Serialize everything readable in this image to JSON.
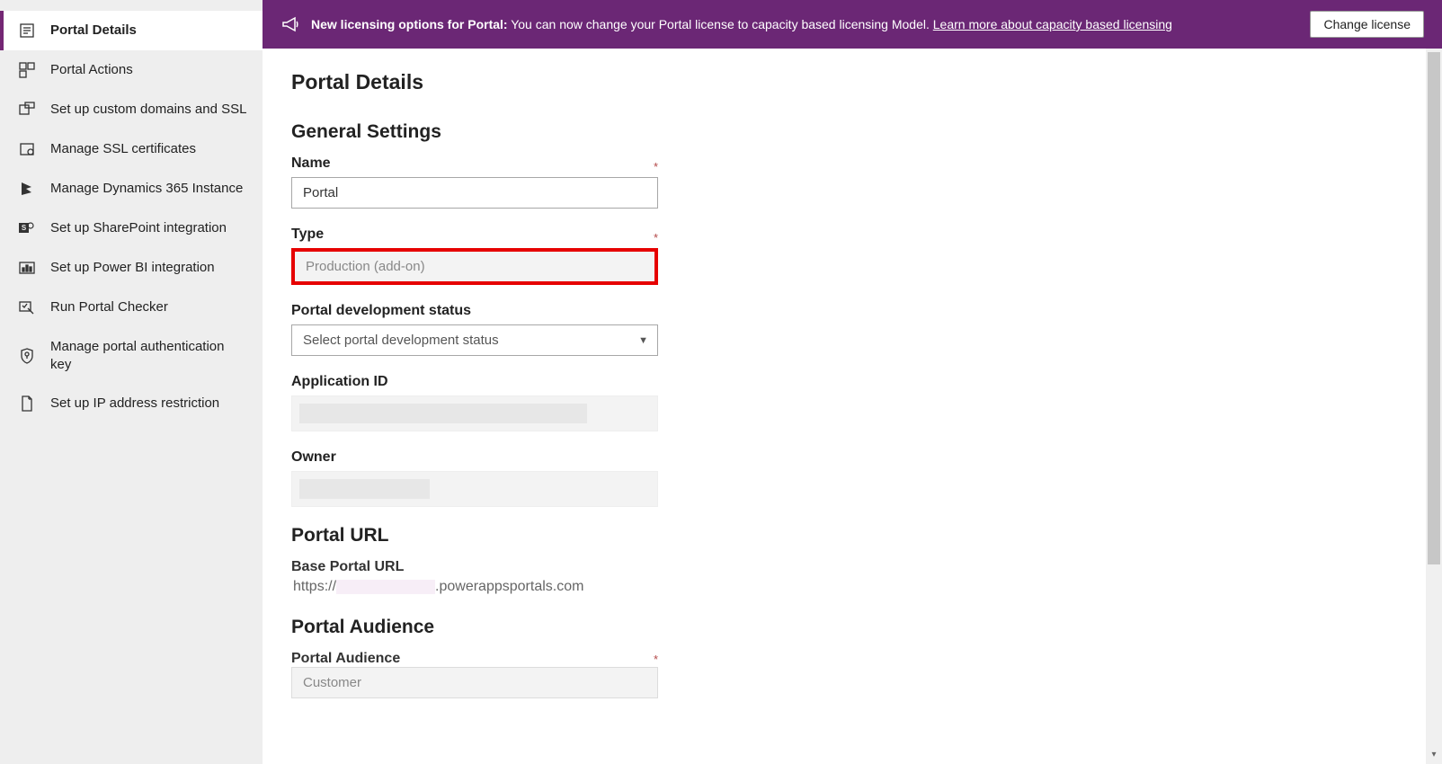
{
  "banner": {
    "bold": "New licensing options for Portal:",
    "text": " You can now change your Portal license to capacity based licensing Model. ",
    "link": "Learn more about capacity based licensing",
    "button": "Change license"
  },
  "sidebar": {
    "items": [
      {
        "label": "Portal Details"
      },
      {
        "label": "Portal Actions"
      },
      {
        "label": "Set up custom domains and SSL"
      },
      {
        "label": "Manage SSL certificates"
      },
      {
        "label": "Manage Dynamics 365 Instance"
      },
      {
        "label": "Set up SharePoint integration"
      },
      {
        "label": "Set up Power BI integration"
      },
      {
        "label": "Run Portal Checker"
      },
      {
        "label": "Manage portal authentication key"
      },
      {
        "label": "Set up IP address restriction"
      }
    ]
  },
  "page": {
    "title": "Portal Details",
    "general_settings": "General Settings",
    "name_label": "Name",
    "name_value": "Portal",
    "type_label": "Type",
    "type_value": "Production (add-on)",
    "dev_status_label": "Portal development status",
    "dev_status_placeholder": "Select portal development status",
    "app_id_label": "Application ID",
    "owner_label": "Owner",
    "portal_url_section": "Portal URL",
    "base_url_label": "Base Portal URL",
    "base_url_prefix": "https://",
    "base_url_suffix": ".powerappsportals.com",
    "audience_section": "Portal Audience",
    "audience_label": "Portal Audience",
    "audience_value": "Customer",
    "required_mark": "*"
  }
}
